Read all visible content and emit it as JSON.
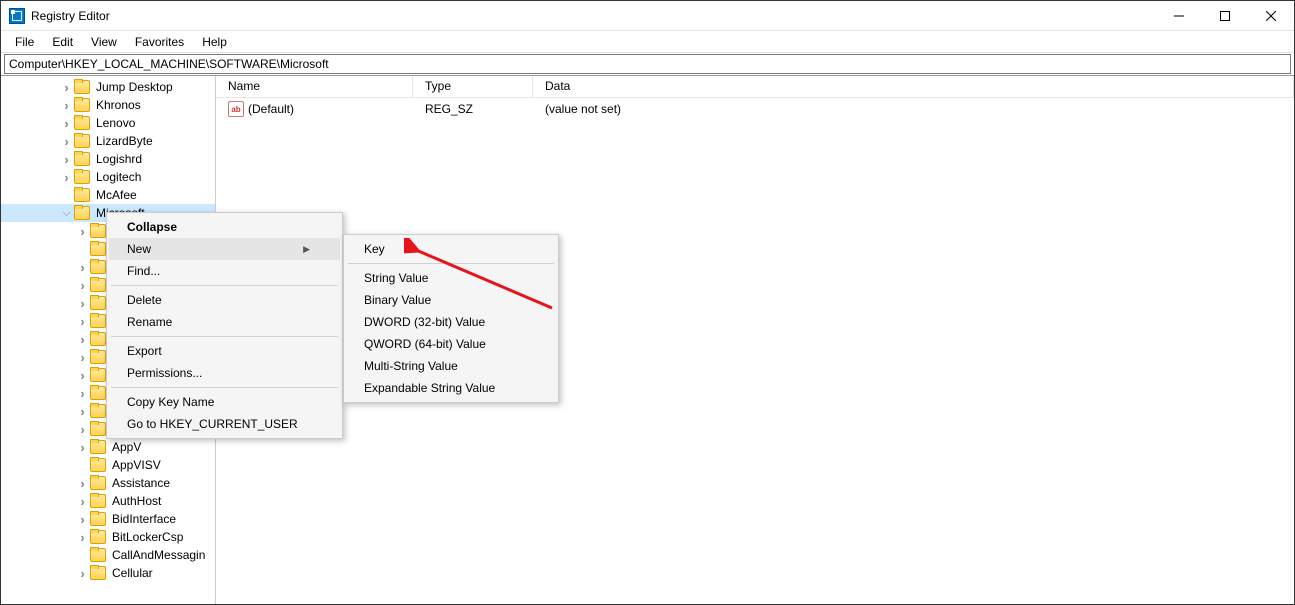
{
  "title": "Registry Editor",
  "menus": [
    "File",
    "Edit",
    "View",
    "Favorites",
    "Help"
  ],
  "address": "Computer\\HKEY_LOCAL_MACHINE\\SOFTWARE\\Microsoft",
  "tree": {
    "items": [
      {
        "label": "Jump Desktop",
        "indent": 58,
        "exp": "closed"
      },
      {
        "label": "Khronos",
        "indent": 58,
        "exp": "closed"
      },
      {
        "label": "Lenovo",
        "indent": 58,
        "exp": "closed"
      },
      {
        "label": "LizardByte",
        "indent": 58,
        "exp": "closed"
      },
      {
        "label": "Logishrd",
        "indent": 58,
        "exp": "closed"
      },
      {
        "label": "Logitech",
        "indent": 58,
        "exp": "closed"
      },
      {
        "label": "McAfee",
        "indent": 58,
        "exp": "none"
      },
      {
        "label": "Microsoft",
        "indent": 58,
        "exp": "open",
        "selected": true
      },
      {
        "label": "",
        "indent": 74,
        "exp": "closed"
      },
      {
        "label": "",
        "indent": 74,
        "exp": "none"
      },
      {
        "label": "",
        "indent": 74,
        "exp": "closed"
      },
      {
        "label": "",
        "indent": 74,
        "exp": "closed"
      },
      {
        "label": "",
        "indent": 74,
        "exp": "closed"
      },
      {
        "label": "",
        "indent": 74,
        "exp": "closed"
      },
      {
        "label": "",
        "indent": 74,
        "exp": "closed"
      },
      {
        "label": "",
        "indent": 74,
        "exp": "closed"
      },
      {
        "label": "",
        "indent": 74,
        "exp": "closed"
      },
      {
        "label": "",
        "indent": 74,
        "exp": "closed"
      },
      {
        "label": "",
        "indent": 74,
        "exp": "closed"
      },
      {
        "label": "",
        "indent": 74,
        "exp": "closed"
      },
      {
        "label": "AppV",
        "indent": 74,
        "exp": "closed"
      },
      {
        "label": "AppVISV",
        "indent": 74,
        "exp": "none"
      },
      {
        "label": "Assistance",
        "indent": 74,
        "exp": "closed"
      },
      {
        "label": "AuthHost",
        "indent": 74,
        "exp": "closed"
      },
      {
        "label": "BidInterface",
        "indent": 74,
        "exp": "closed"
      },
      {
        "label": "BitLockerCsp",
        "indent": 74,
        "exp": "closed"
      },
      {
        "label": "CallAndMessagin",
        "indent": 74,
        "exp": "none"
      },
      {
        "label": "Cellular",
        "indent": 74,
        "exp": "closed"
      }
    ]
  },
  "columns": {
    "name": "Name",
    "type": "Type",
    "data": "Data"
  },
  "values": [
    {
      "name": "(Default)",
      "type": "REG_SZ",
      "data": "(value not set)"
    }
  ],
  "contextMenu": {
    "collapse": "Collapse",
    "new": "New",
    "find": "Find...",
    "delete": "Delete",
    "rename": "Rename",
    "export": "Export",
    "permissions": "Permissions...",
    "copyKeyName": "Copy Key Name",
    "goto": "Go to HKEY_CURRENT_USER"
  },
  "newSubmenu": {
    "key": "Key",
    "string": "String Value",
    "binary": "Binary Value",
    "dword": "DWORD (32-bit) Value",
    "qword": "QWORD (64-bit) Value",
    "multi": "Multi-String Value",
    "expand": "Expandable String Value"
  }
}
